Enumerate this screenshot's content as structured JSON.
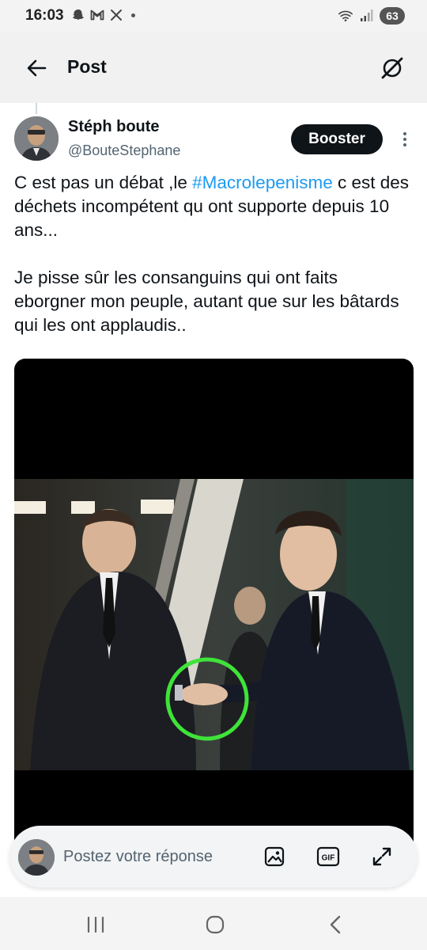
{
  "status_bar": {
    "time": "16:03",
    "left_icons": [
      "snapchat-icon",
      "gmail-icon",
      "x-icon"
    ],
    "battery": "63"
  },
  "header": {
    "title": "Post"
  },
  "post": {
    "author_name": "Stéph boute",
    "author_handle": "@BouteStephane",
    "boost_label": "Booster",
    "text_part1": "C est pas un débat ,le ",
    "hashtag": "#Macrolepenisme",
    "text_part2": "  c est des déchets incompétent qu ont supporte depuis 10 ans...",
    "text_paragraph2": "Je pisse sûr les consanguins qui ont faits eborgner  mon peuple,  autant que sur les bâtards qui les ont applaudis..",
    "accent_color": "#1d9bf0"
  },
  "reply_bar": {
    "placeholder": "Postez votre réponse",
    "icons": [
      "image-icon",
      "gif-icon",
      "expand-icon"
    ],
    "gif_label": "GIF"
  },
  "nav_bar": {
    "buttons": [
      "recent-apps-icon",
      "home-icon",
      "back-icon"
    ]
  }
}
